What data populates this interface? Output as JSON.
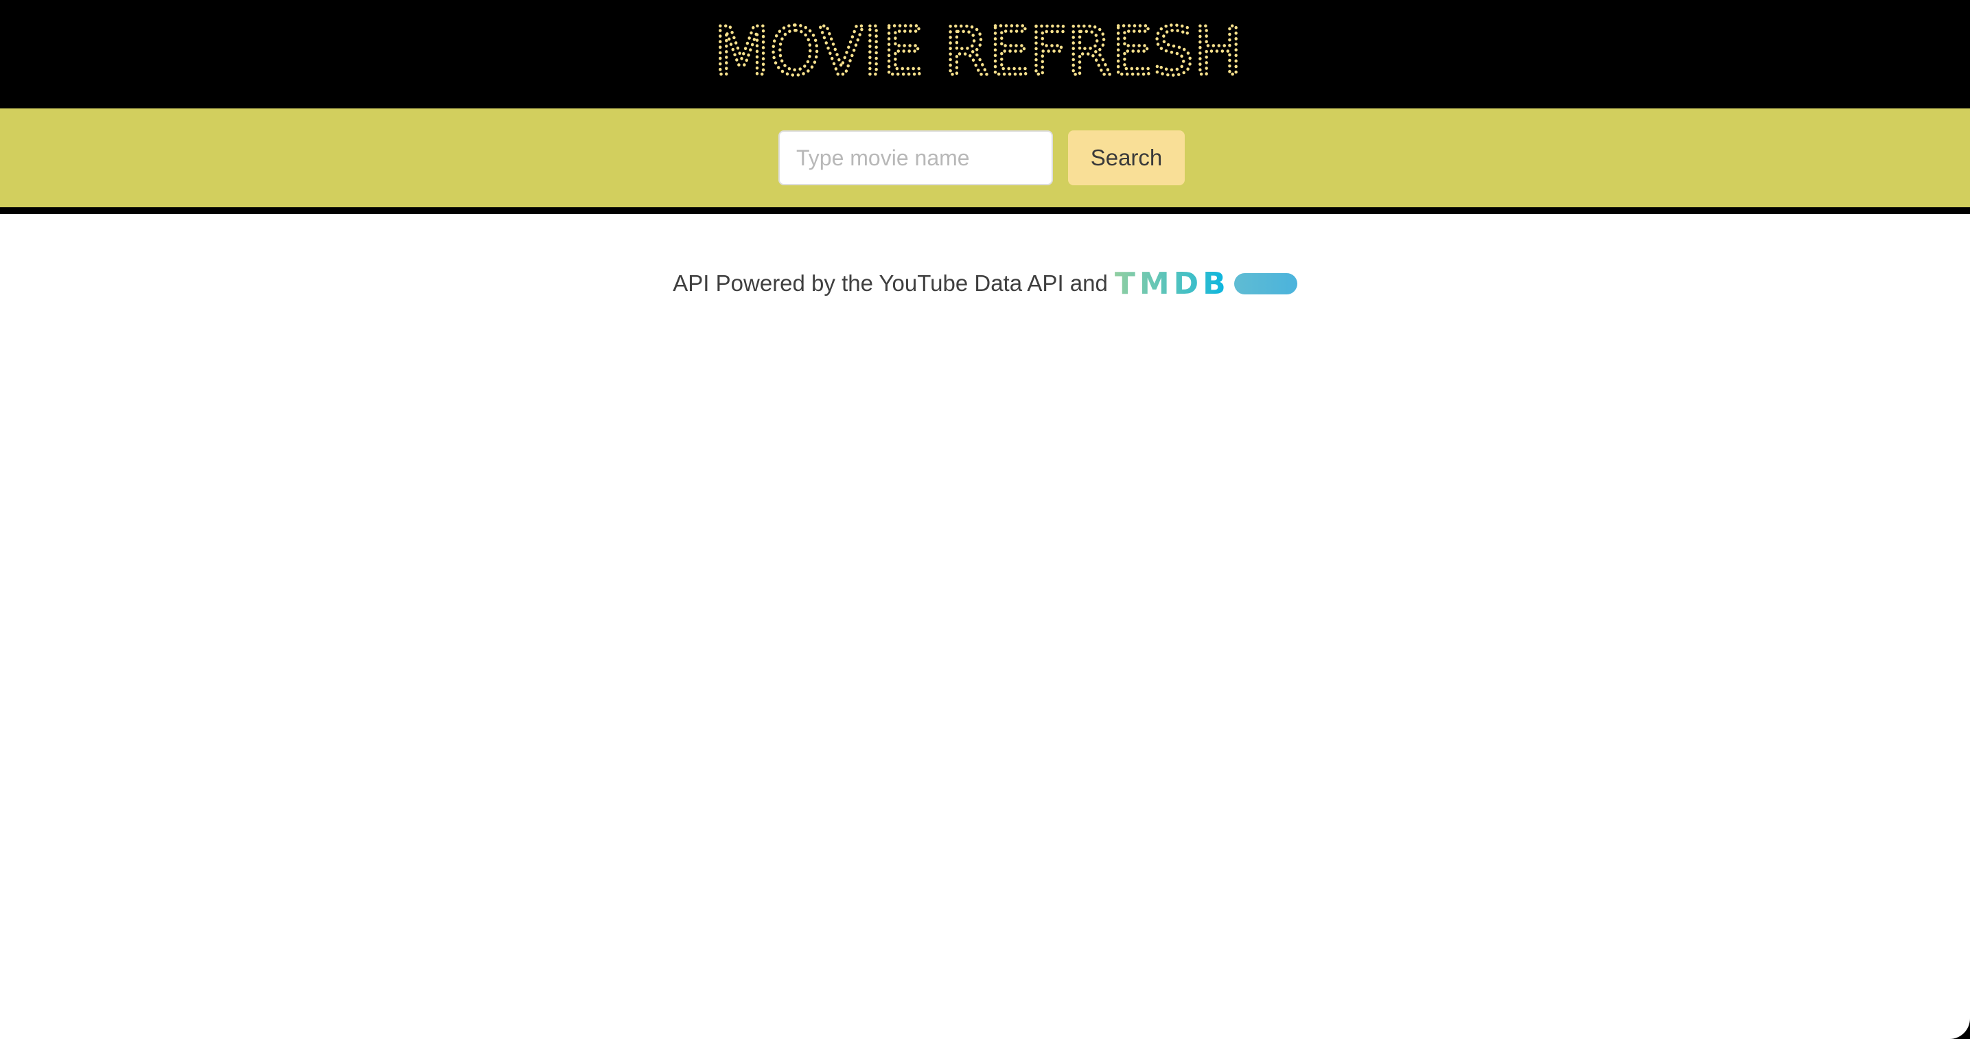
{
  "header": {
    "logo_text": "MOVIE REFRESH",
    "logo_color": "#f6e08c"
  },
  "search": {
    "placeholder": "Type movie name",
    "value": "",
    "button_label": "Search"
  },
  "credits": {
    "text": "API Powered by the YouTube Data API and",
    "tmdb_logo_text": "TMDB"
  },
  "colors": {
    "header_bg": "#000000",
    "search_bar_bg": "#d2cf5e",
    "search_button_bg": "#f9df97",
    "tmdb_green": "#90cea1",
    "tmdb_blue": "#01b4e4"
  }
}
